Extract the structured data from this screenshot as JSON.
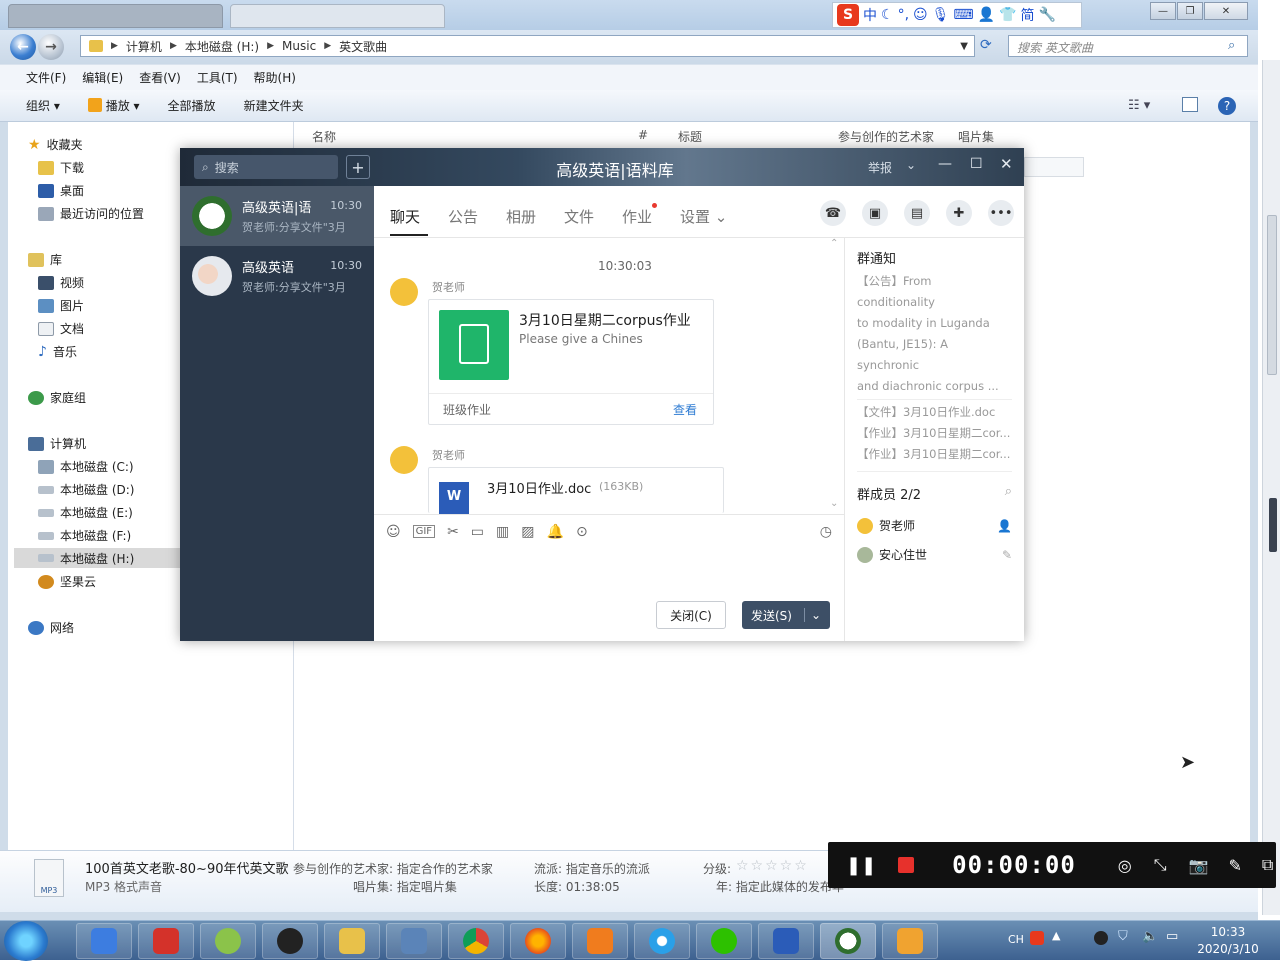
{
  "explorer": {
    "breadcrumb": [
      "计算机",
      "本地磁盘 (H:)",
      "Music",
      "英文歌曲"
    ],
    "search_placeholder": "搜索 英文歌曲",
    "menu": [
      "文件(F)",
      "编辑(E)",
      "查看(V)",
      "工具(T)",
      "帮助(H)"
    ],
    "toolbar": {
      "organize": "组织",
      "play": "播放",
      "play_all": "全部播放",
      "new_folder": "新建文件夹"
    },
    "columns": {
      "name": "名称",
      "number": "#",
      "title": "标题",
      "artists": "参与创作的艺术家",
      "album": "唱片集"
    },
    "nav": {
      "favorites": "收藏夹",
      "downloads": "下载",
      "desktop": "桌面",
      "recent": "最近访问的位置",
      "libraries": "库",
      "videos": "视频",
      "pictures": "图片",
      "documents": "文档",
      "music": "音乐",
      "homegroup": "家庭组",
      "computer": "计算机",
      "drive_c": "本地磁盘 (C:)",
      "drive_d": "本地磁盘 (D:)",
      "drive_e": "本地磁盘 (E:)",
      "drive_f": "本地磁盘 (F:)",
      "drive_h": "本地磁盘 (H:)",
      "jianguoyun": "坚果云",
      "network": "网络"
    },
    "details": {
      "filename": "100首英文老歌-80~90年代英文歌",
      "filetype": "MP3 格式声音",
      "artists": "参与创作的艺术家: 指定合作的艺术家",
      "album": "唱片集: 指定唱片集",
      "genre": "流派: 指定音乐的流派",
      "length": "长度: 01:38:05",
      "rating_label": "分级:",
      "year": "年: 指定此媒体的发布年",
      "mp3_label": "MP3"
    }
  },
  "ime": {
    "s": "S",
    "zh": "中",
    "simp": "简"
  },
  "chat": {
    "title": "高级英语|语料库",
    "report": "举报",
    "search_placeholder": "搜索",
    "conversations": [
      {
        "name": "高级英语|语",
        "time": "10:30",
        "preview": "贺老师:分享文件\"3月"
      },
      {
        "name": "高级英语",
        "time": "10:30",
        "preview": "贺老师:分享文件\"3月"
      }
    ],
    "tabs": [
      "聊天",
      "公告",
      "相册",
      "文件",
      "作业",
      "设置"
    ],
    "messages": {
      "timestamp": "10:30:03",
      "sender1": "贺老师",
      "card_title": "3月10日星期二corpus作业",
      "card_desc": "Please give a Chines",
      "card_footer": "班级作业",
      "card_action": "查看",
      "sender2": "贺老师",
      "file_name": "3月10日作业.doc",
      "file_size": "(163KB)"
    },
    "buttons": {
      "close": "关闭(C)",
      "send": "发送(S)"
    },
    "side": {
      "notice_title": "群通知",
      "notice_lines": [
        "【公告】From conditionality",
        "to modality in Luganda",
        "(Bantu, JE15): A synchronic",
        "and diachronic corpus ..."
      ],
      "items": [
        "【文件】3月10日作业.doc",
        "【作业】3月10日星期二cor...",
        "【作业】3月10日星期二cor..."
      ],
      "members_title": "群成员 2/2",
      "members": [
        "贺老师",
        "安心住世"
      ]
    }
  },
  "recorder": {
    "time": "00:00:00"
  },
  "taskbar": {
    "lang": "CH",
    "time": "10:33",
    "date": "2020/3/10"
  }
}
